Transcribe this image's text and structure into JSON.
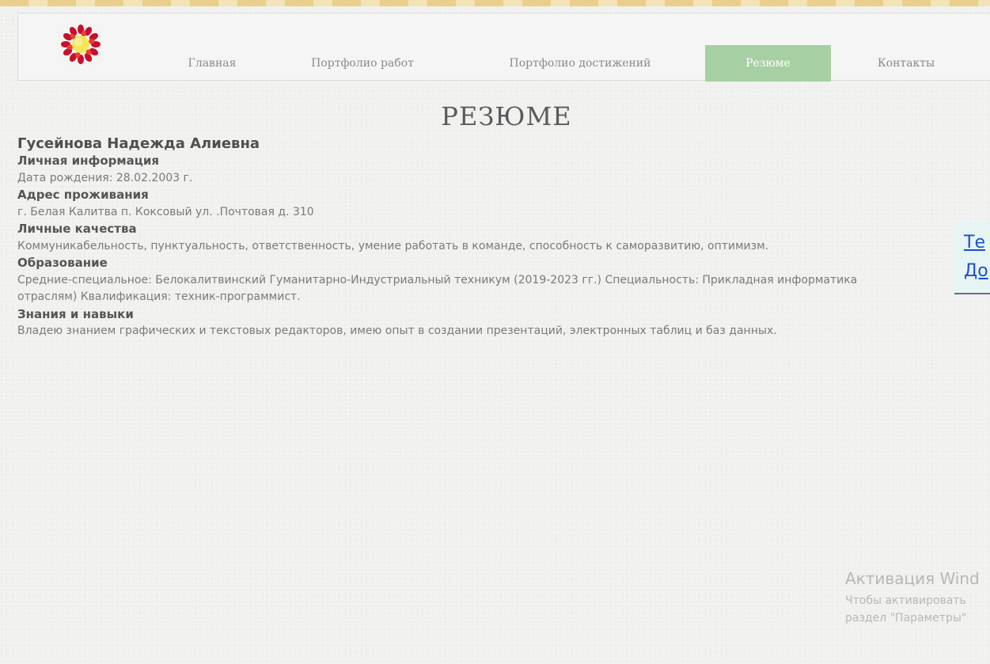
{
  "nav": {
    "logo_icon": "sun-flower-logo-icon",
    "items": [
      {
        "label": "Главная",
        "active": false
      },
      {
        "label": "Портфолио работ",
        "active": false
      },
      {
        "label": "Портфолио достижений",
        "active": false
      },
      {
        "label": "Резюме",
        "active": true
      },
      {
        "label": "Контакты",
        "active": false
      }
    ],
    "active_color": "#a7cfa4"
  },
  "page": {
    "title": "РЕЗЮМЕ"
  },
  "resume": {
    "name": "Гусейнова Надежда Алиевна",
    "personal_heading": "Личная информация",
    "birth_date": "Дата рождения: 28.02.2003 г.",
    "address_heading": "Адрес проживания",
    "address": "г. Белая Калитва п. Коксовый ул. .Почтовая д. 310",
    "qualities_heading": "Личные качества",
    "qualities": "Коммуникабельность, пунктуальность, ответственность, умение  работать в команде, способность к саморазвитию, оптимизм.",
    "education_heading": "Образование",
    "education_line1": "Средние-специальное:  Белокалитвинский Гуманитарно-Индустриальный техникум (2019-2023 гг.) Специальность: Прикладная информатика",
    "education_line2": "отраслям) Квалификация: техник-программист.",
    "skills_heading": "Знания и навыки",
    "skills": "Владею знанием графических и текстовых редакторов, имею опыт в создании презентаций, электронных таблиц и баз данных."
  },
  "side_links": {
    "link1": "Те",
    "link2": "До"
  },
  "activation": {
    "title": "Активация Wind",
    "line1": "Чтобы активировать",
    "line2": "раздел \"Параметры\""
  }
}
